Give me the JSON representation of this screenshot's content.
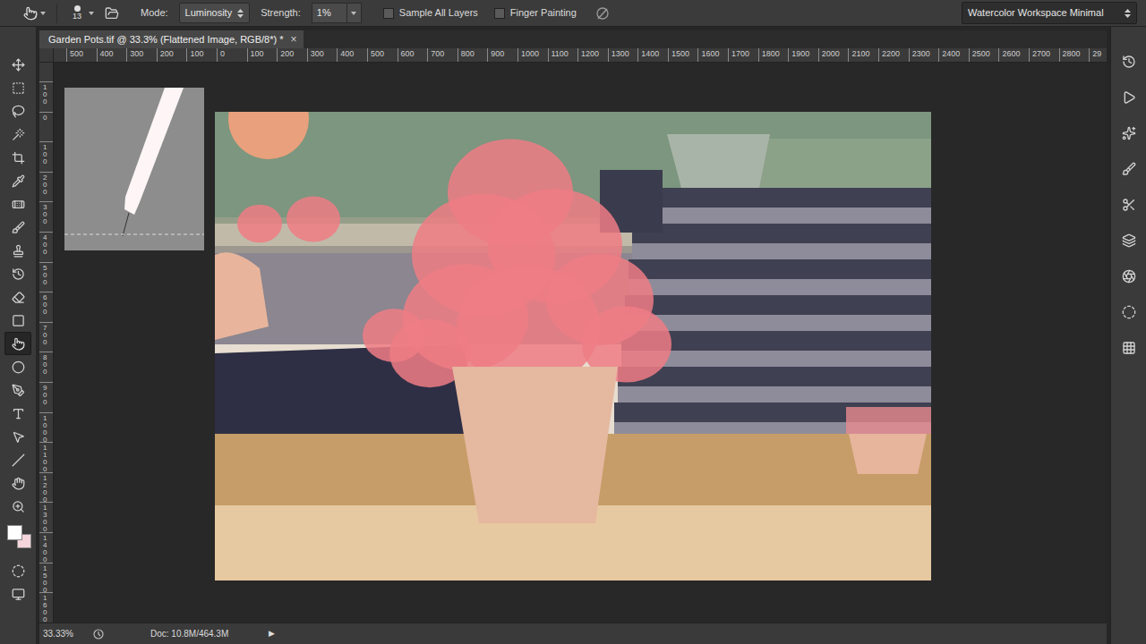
{
  "options_bar": {
    "brush_size": "13",
    "mode_label": "Mode:",
    "mode": "Luminosity",
    "strength_label": "Strength:",
    "strength": "1%",
    "checkboxes": [
      {
        "label": "Sample All Layers",
        "checked": false
      },
      {
        "label": "Finger Painting",
        "checked": false
      }
    ],
    "workspace": "Watercolor Workspace Minimal"
  },
  "document_tab": {
    "title": "Garden Pots.tif @ 33.3% (Flattened Image, RGB/8*) *",
    "close": "×",
    "selected": true
  },
  "ruler": {
    "horizontal": [
      "500",
      "400",
      "300",
      "200",
      "100",
      "0",
      "100",
      "200",
      "300",
      "400",
      "500",
      "600",
      "700",
      "800",
      "900",
      "1000",
      "1100",
      "1200",
      "1300",
      "1400",
      "1500",
      "1600",
      "1700",
      "1800",
      "1900",
      "2000",
      "2100",
      "2200",
      "2300",
      "2400",
      "2500",
      "2600",
      "2700",
      "2800",
      "29"
    ],
    "vertical": [
      "100",
      "0",
      "100",
      "200",
      "300",
      "400",
      "500",
      "600",
      "700",
      "800",
      "900",
      "1000",
      "1100",
      "1200",
      "1300",
      "1400",
      "1500",
      "1600"
    ]
  },
  "toolbar": {
    "tools": [
      {
        "selected": false
      },
      {
        "selected": false
      },
      {
        "selected": false
      },
      {
        "selected": false
      },
      {
        "selected": false
      },
      {
        "selected": false
      },
      {
        "selected": false
      },
      {
        "selected": false
      },
      {
        "selected": false
      },
      {
        "selected": false
      },
      {
        "selected": false
      },
      {
        "selected": false
      },
      {
        "selected": true
      },
      {
        "selected": false
      },
      {
        "selected": false
      },
      {
        "selected": false
      },
      {
        "selected": false
      },
      {
        "selected": false
      },
      {
        "selected": false
      },
      {
        "selected": false
      }
    ],
    "swatches": [
      {
        "color": "#ffffff"
      },
      {
        "color": "#f6d5dc"
      }
    ]
  },
  "status_bar": {
    "zoom": "33.33%",
    "doc": "Doc: 10.8M/464.3M",
    "arrow": "▶"
  }
}
